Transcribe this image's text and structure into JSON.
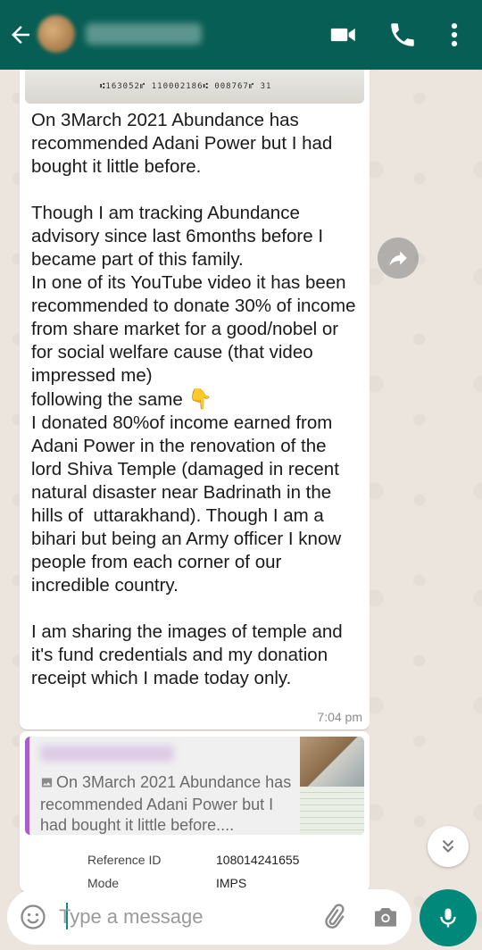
{
  "header": {
    "contact_name": "",
    "back_icon": "arrow-left-icon",
    "video_icon": "video-camera-icon",
    "call_icon": "phone-icon",
    "menu_icon": "more-vertical-icon",
    "color": "#075e54"
  },
  "messages": [
    {
      "image_caption_code": "⑆163052⑈ 110002186⑆ 008767⑈ 31",
      "text_paragraphs": [
        "On 3March 2021 Abundance has recommended Adani Power but I had bought it little before.",
        "Though I am tracking Abundance advisory since last 6months before I became part of this family.\nIn one of its YouTube video it has been recommended to donate 30% of income from share market for a good/nobel or for social welfare cause (that video impressed me)\nfollowing the same",
        "I donated 80%of income earned from Adani Power in the renovation of the lord Shiva Temple (damaged in recent natural disaster near Badrinath in the hills of  uttarakhand). Though I am a bihari but being an Army officer I know people from each corner of our incredible country.",
        "I am sharing the images of temple and it's fund credentials and my donation receipt which I made today only."
      ],
      "emoji": "👇",
      "time": "7:04 pm"
    },
    {
      "quote_author": "",
      "quote_text": "On 3March 2021 Abundance has recommended Adani Power but I had bought it little before....",
      "receipt": [
        {
          "key": "Reference ID",
          "value": "108014241655"
        },
        {
          "key": "Mode",
          "value": "IMPS"
        }
      ]
    }
  ],
  "input": {
    "placeholder": "Type a message",
    "value": ""
  },
  "colors": {
    "accent": "#00897b",
    "quote_bar": "#a85ec8",
    "bubble": "#ffffff"
  }
}
